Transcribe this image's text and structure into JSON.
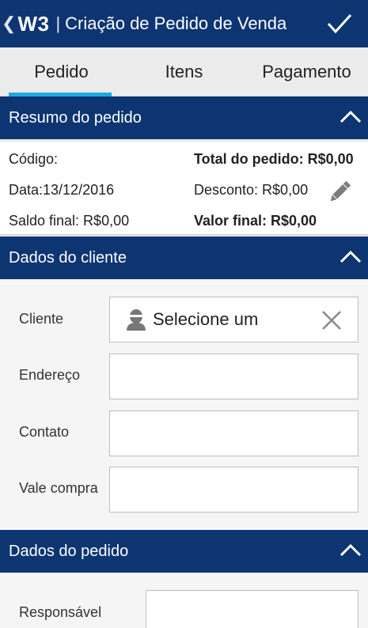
{
  "appbar": {
    "back_glyph": "❮",
    "logo": "W3",
    "separator": "|",
    "title": "Criação de Pedido de Venda"
  },
  "tabs": [
    {
      "label": "Pedido",
      "active": true
    },
    {
      "label": "Itens",
      "active": false
    },
    {
      "label": "Pagamento",
      "active": false
    }
  ],
  "summary": {
    "header": "Resumo do pedido",
    "codigo": "Código:",
    "data": "Data:13/12/2016",
    "saldo": "Saldo final: R$0,00",
    "total": "Total do pedido: R$0,00",
    "desconto": "Desconto: R$0,00",
    "valor_final": "Valor final: R$0,00"
  },
  "cliente": {
    "header": "Dados do cliente",
    "fields": [
      {
        "label": "Cliente",
        "value": "Selecione um"
      },
      {
        "label": "Endereço",
        "value": ""
      },
      {
        "label": "Contato",
        "value": ""
      },
      {
        "label": "Vale compra",
        "value": ""
      }
    ]
  },
  "pedido": {
    "header": "Dados do pedido",
    "fields": [
      {
        "label": "Responsável",
        "value": ""
      }
    ]
  },
  "colors": {
    "primary": "#0d3572",
    "accent": "#1ea7e1"
  },
  "icons": {
    "confirm": "check-icon",
    "collapse": "chevron-up-icon",
    "edit": "pencil-icon",
    "user": "user-icon",
    "clear": "close-icon"
  }
}
